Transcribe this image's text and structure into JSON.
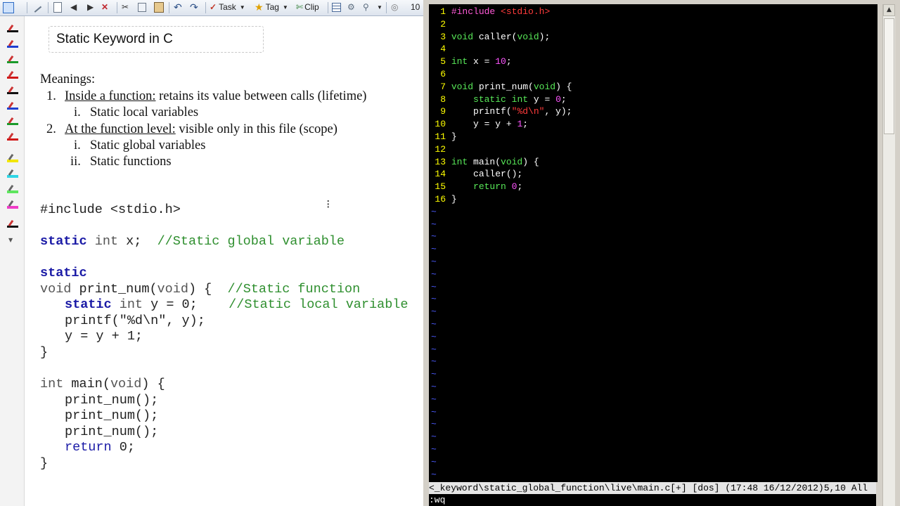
{
  "toolbar": {
    "task_label": "Task",
    "tag_label": "Tag",
    "clip_label": "Clip",
    "zoom_label": "10"
  },
  "notes": {
    "title": "Static Keyword in C",
    "meanings_label": "Meanings:",
    "item1_num": "1.",
    "item1_underlined": "Inside a function:",
    "item1_rest": " retains its value between calls (lifetime)",
    "item1_sub_i_num": "i.",
    "item1_sub_i": "Static local variables",
    "item2_num": "2.",
    "item2_underlined": "At the function level:",
    "item2_rest": " visible only in this file (scope)",
    "item2_sub_i_num": "i.",
    "item2_sub_i": "Static global variables",
    "item2_sub_ii_num": "ii.",
    "item2_sub_ii": "Static functions",
    "code": {
      "include": "#include <stdio.h>",
      "l1_kw": "static",
      "l1_ty": " int",
      "l1_rest": " x;  ",
      "l1_cm": "//Static global variable",
      "l2_kw": "static",
      "l3_ty": "void",
      "l3_rest": " print_num(",
      "l3_ty2": "void",
      "l3_rest2": ") {  ",
      "l3_cm": "//Static function",
      "l4_kw": "static",
      "l4_ty": " int",
      "l4_rest": " y = 0;    ",
      "l4_cm": "//Static local variable",
      "l5": "printf(\"%d\\n\", y);",
      "l6": "y = y + 1;",
      "l7": "}",
      "l8_ty": "int",
      "l8_rest": " main(",
      "l8_ty2": "void",
      "l8_rest2": ") {",
      "l9": "print_num();",
      "l10": "print_num();",
      "l11": "print_num();",
      "l12_kw": "return",
      "l12_rest": " 0;",
      "l13": "}"
    }
  },
  "vim": {
    "lines": [
      {
        "n": "1",
        "parts": [
          [
            "vp",
            "#include "
          ],
          [
            "vs",
            "<stdio.h>"
          ]
        ]
      },
      {
        "n": "2",
        "parts": []
      },
      {
        "n": "3",
        "parts": [
          [
            "vk",
            "void"
          ],
          [
            "",
            " caller("
          ],
          [
            "vk",
            "void"
          ],
          [
            "",
            ");"
          ]
        ]
      },
      {
        "n": "4",
        "parts": []
      },
      {
        "n": "5",
        "parts": [
          [
            "vk",
            "int"
          ],
          [
            "",
            " x = "
          ],
          [
            "vn",
            "10"
          ],
          [
            "",
            ";"
          ]
        ]
      },
      {
        "n": "6",
        "parts": []
      },
      {
        "n": "7",
        "parts": [
          [
            "vk",
            "void"
          ],
          [
            "",
            " print_num("
          ],
          [
            "vk",
            "void"
          ],
          [
            "",
            ") {"
          ]
        ]
      },
      {
        "n": "8",
        "parts": [
          [
            "",
            "    "
          ],
          [
            "vk",
            "static int"
          ],
          [
            "",
            " y = "
          ],
          [
            "vn",
            "0"
          ],
          [
            "",
            ";"
          ]
        ]
      },
      {
        "n": "9",
        "parts": [
          [
            "",
            "    printf("
          ],
          [
            "vs",
            "\"%d\\n\""
          ],
          [
            "",
            ", y);"
          ]
        ]
      },
      {
        "n": "10",
        "parts": [
          [
            "",
            "    y = y + "
          ],
          [
            "vn",
            "1"
          ],
          [
            "",
            ";"
          ]
        ]
      },
      {
        "n": "11",
        "parts": [
          [
            "",
            "}"
          ]
        ]
      },
      {
        "n": "12",
        "parts": []
      },
      {
        "n": "13",
        "parts": [
          [
            "vk",
            "int"
          ],
          [
            "",
            " main("
          ],
          [
            "vk",
            "void"
          ],
          [
            "",
            ") {"
          ]
        ]
      },
      {
        "n": "14",
        "parts": [
          [
            "",
            "    caller();"
          ]
        ]
      },
      {
        "n": "15",
        "parts": [
          [
            "",
            "    "
          ],
          [
            "vk",
            "return"
          ],
          [
            "",
            " "
          ],
          [
            "vn",
            "0"
          ],
          [
            "",
            ";"
          ]
        ]
      },
      {
        "n": "16",
        "parts": [
          [
            "",
            "}"
          ]
        ]
      }
    ],
    "tilde": "~",
    "status_line": "<_keyword\\static_global_function\\live\\main.c[+] [dos] (17:48 16/12/2012)5,10 All",
    "command_line": ":wq"
  },
  "colors": {
    "keyword_blue": "#1a1aa6",
    "comment_green": "#2f8f2f",
    "vim_background": "#000000",
    "vim_keyword": "#58e858",
    "vim_string": "#ff3b3b",
    "vim_number": "#ff55ff",
    "vim_line_number": "#ffff00",
    "vim_tilde": "#4b5bff"
  }
}
